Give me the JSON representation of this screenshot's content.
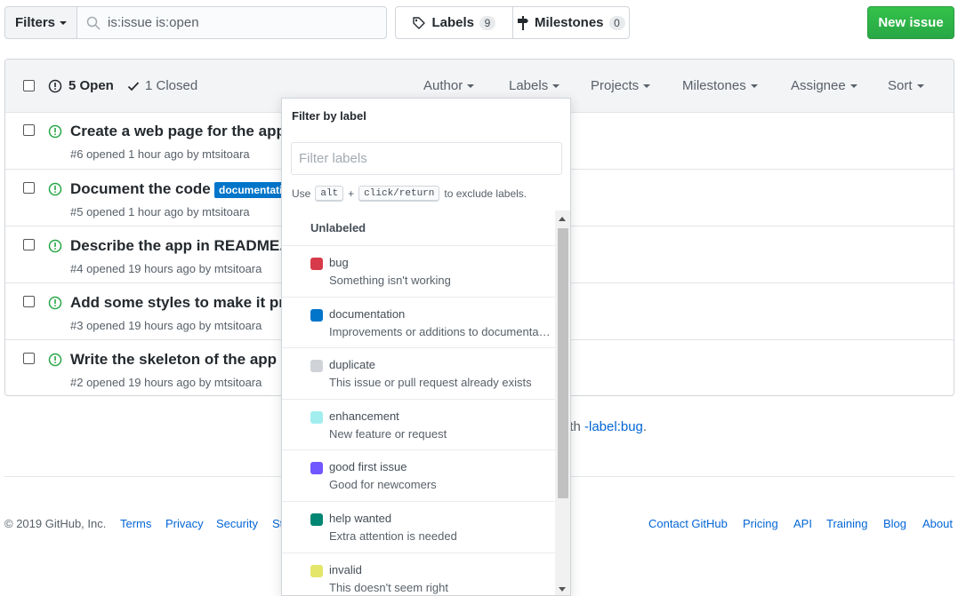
{
  "topbar": {
    "filters_label": "Filters",
    "search_value": "is:issue is:open",
    "labels_tab": "Labels",
    "labels_count": "9",
    "milestones_tab": "Milestones",
    "milestones_count": "0",
    "new_issue_label": "New issue"
  },
  "header": {
    "open_label": "5 Open",
    "closed_label": "1 Closed",
    "filters": [
      "Author",
      "Labels",
      "Projects",
      "Milestones",
      "Assignee",
      "Sort"
    ]
  },
  "issues": [
    {
      "title": "Create a web page for the app",
      "meta": "#6 opened 1 hour ago by mtsitoara",
      "label": ""
    },
    {
      "title": "Document the code",
      "meta": "#5 opened 1 hour ago by mtsitoara",
      "label": "documentation"
    },
    {
      "title": "Describe the app in README.md",
      "meta": "#4 opened 19 hours ago by mtsitoara",
      "label": ""
    },
    {
      "title": "Add some styles to make it pretty",
      "meta": "#3 opened 19 hours ago by mtsitoara",
      "label": ""
    },
    {
      "title": "Write the skeleton of the app",
      "meta": "#2 opened 19 hours ago by mtsitoara",
      "label": ""
    }
  ],
  "hint": {
    "prefix": "ith ",
    "link": "-label:bug",
    "suffix": "."
  },
  "footer": {
    "copyright": "© 2019 GitHub, Inc.",
    "left_links": [
      "Terms",
      "Privacy",
      "Security",
      "St"
    ],
    "right_links": [
      "Contact GitHub",
      "Pricing",
      "API",
      "Training",
      "Blog",
      "About"
    ]
  },
  "dropdown": {
    "title": "Filter by label",
    "filter_placeholder": "Filter labels",
    "note_use": "Use",
    "note_key1": "alt",
    "note_plus": "+",
    "note_key2": "click/return",
    "note_suffix": "to exclude labels.",
    "unlabeled": "Unlabeled",
    "labels": [
      {
        "name": "bug",
        "desc": "Something isn't working",
        "color": "#d73a4a"
      },
      {
        "name": "documentation",
        "desc": "Improvements or additions to documentation",
        "color": "#0075ca"
      },
      {
        "name": "duplicate",
        "desc": "This issue or pull request already exists",
        "color": "#cfd3d7"
      },
      {
        "name": "enhancement",
        "desc": "New feature or request",
        "color": "#a2eeef"
      },
      {
        "name": "good first issue",
        "desc": "Good for newcomers",
        "color": "#7057ff"
      },
      {
        "name": "help wanted",
        "desc": "Extra attention is needed",
        "color": "#008672"
      },
      {
        "name": "invalid",
        "desc": "This doesn't seem right",
        "color": "#e4e669"
      }
    ]
  }
}
